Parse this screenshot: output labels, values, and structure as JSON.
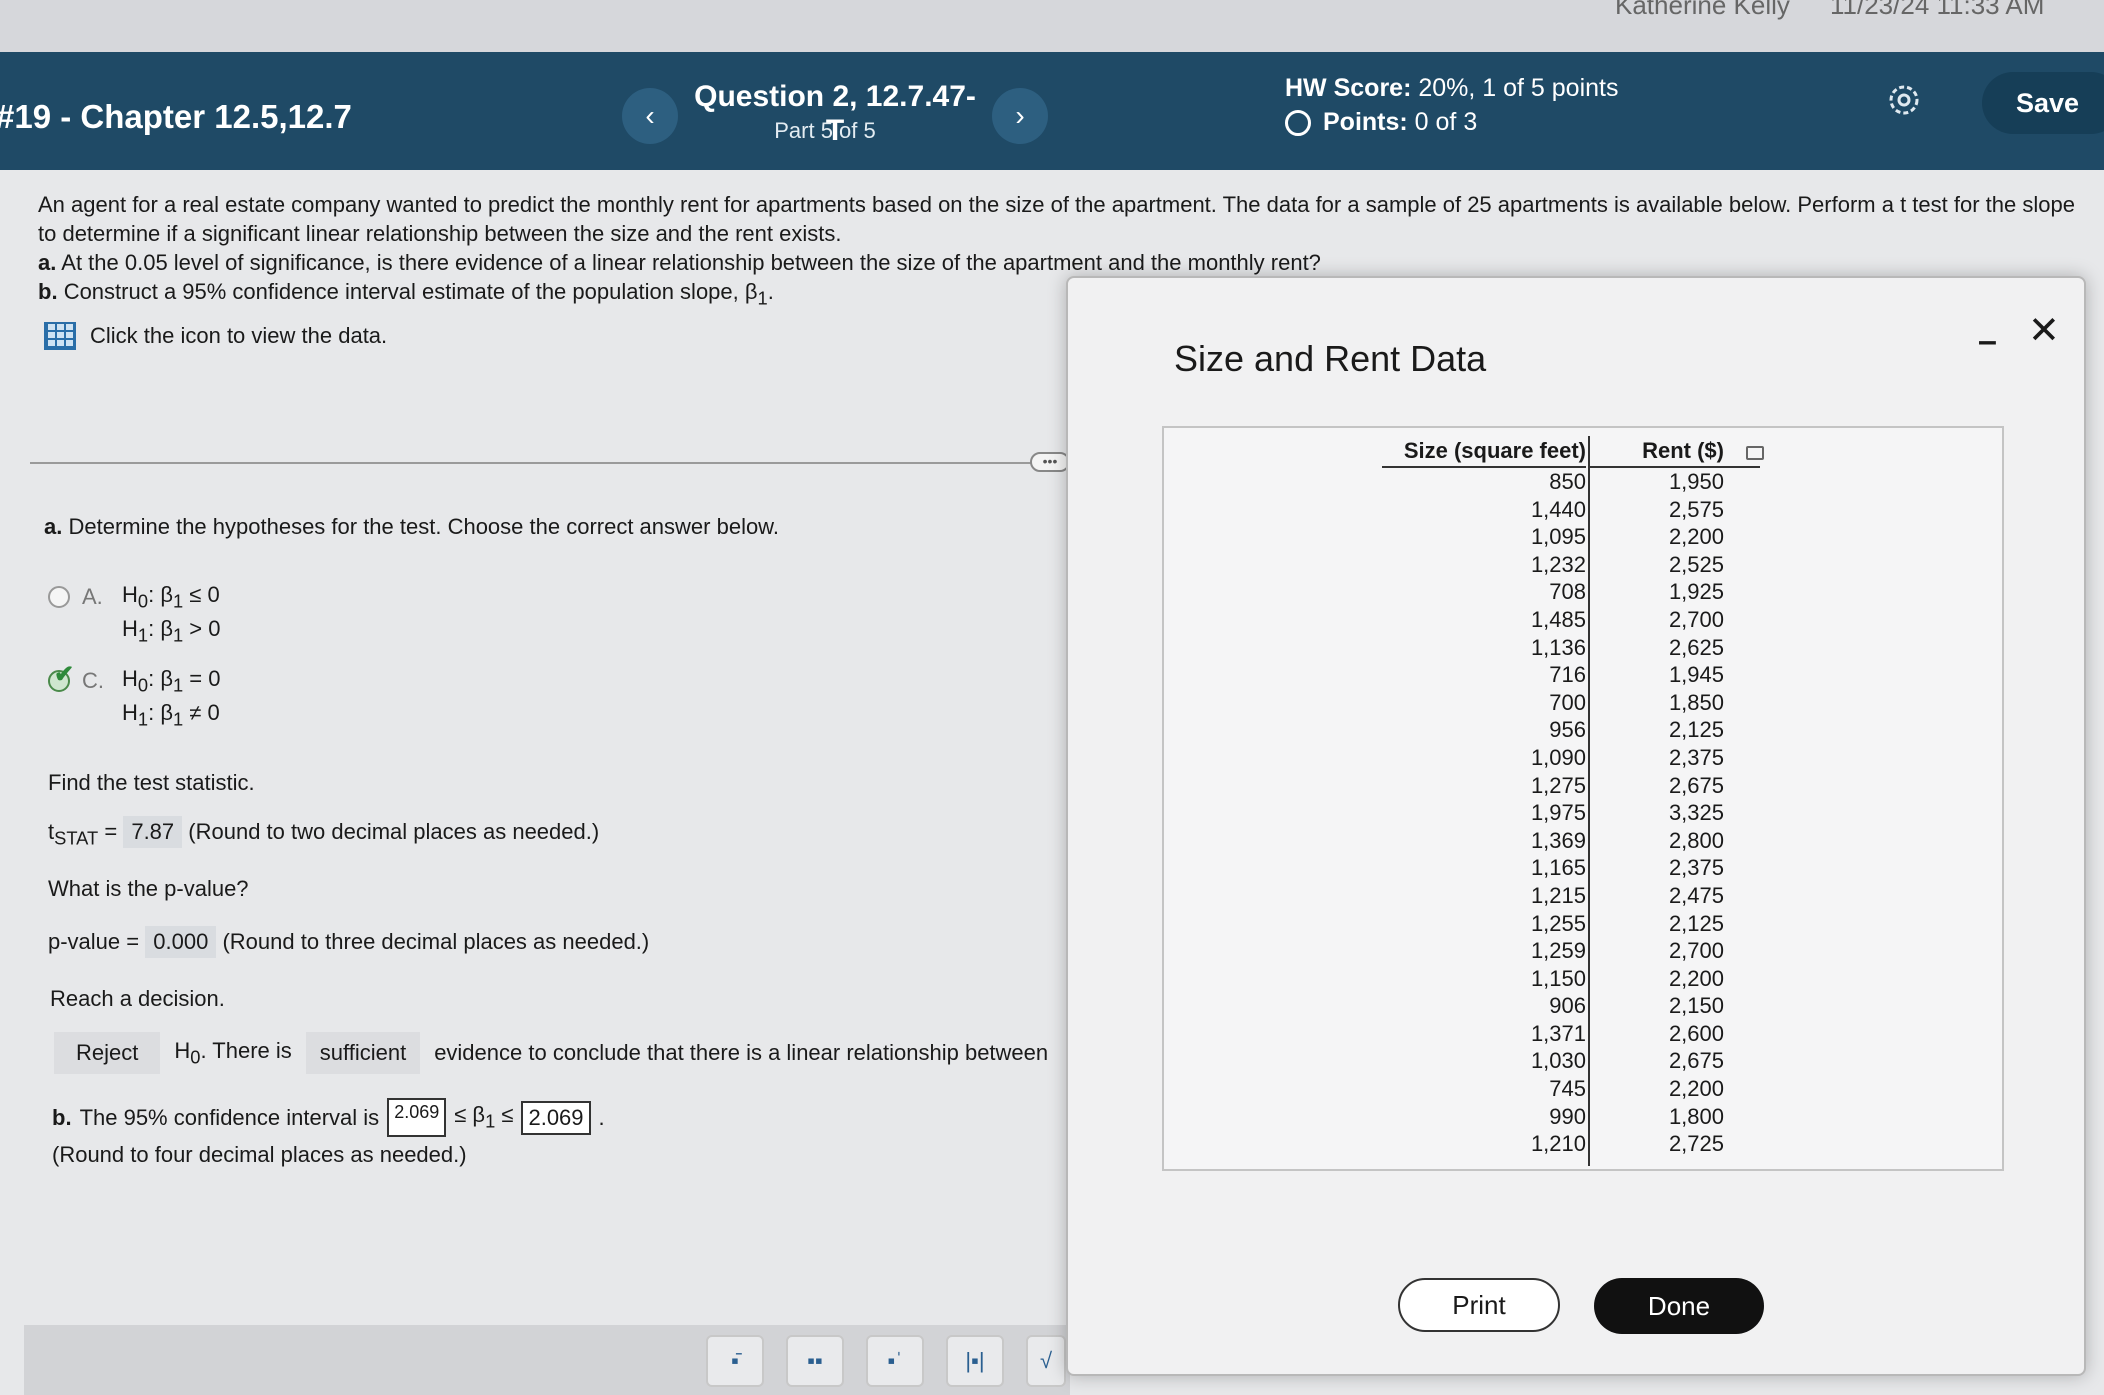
{
  "top_strip": {
    "user": "Katherine Kelly",
    "time": "11/23/24 11:33 AM"
  },
  "header": {
    "hw_title": "#19 - Chapter 12.5,12.7",
    "question_title": "Question 2, 12.7.47-T",
    "question_part": "Part 5 of 5",
    "score_label": "HW Score:",
    "score_value": "20%, 1 of 5 points",
    "points_label": "Points:",
    "points_value": "0 of 3",
    "save_label": "Save",
    "prev_icon": "chevron-left-icon",
    "next_icon": "chevron-right-icon",
    "settings_icon": "gear-icon"
  },
  "problem": {
    "line1": "An agent for a real estate company wanted to predict the monthly rent for apartments based on the size of the apartment. The data for a sample of 25 apartments is available below. Perform a t test for the slope",
    "line2": "to determine if a significant linear relationship between the size and the rent exists.",
    "a_label": "a.",
    "a_text": "At the 0.05 level of significance, is there evidence of a linear relationship between the size of the apartment and the monthly rent?",
    "b_label": "b.",
    "b_text": "Construct a 95% confidence interval estimate of the population slope, β",
    "data_link": "Click the icon to view the data."
  },
  "part_a": {
    "prompt_label": "a.",
    "prompt": "Determine the hypotheses for the test. Choose the correct answer below.",
    "option_a_letter": "A.",
    "option_a_h0": "H",
    "option_a_h0_rest": ": β",
    "option_a_h0_rel": " ≤ 0",
    "option_a_h1_rel": " > 0",
    "option_c_letter": "C.",
    "option_c_h0_rel": " = 0",
    "option_c_h1_rel": " ≠ 0",
    "test_stat_prompt": "Find the test statistic.",
    "t_label": "t",
    "t_sub": "STAT",
    "t_value": "7.87",
    "t_note": "(Round to two decimal places as needed.)",
    "p_prompt": "What is the p-value?",
    "p_label": "p-value =",
    "p_value": "0.000",
    "p_note": "(Round to three decimal places as needed.)",
    "decision_prompt": "Reach a decision.",
    "decision_choice": "Reject",
    "decision_mid": ". There is",
    "evidence_choice": "sufficient",
    "decision_tail": "evidence to conclude that there is a linear relationship between"
  },
  "part_b": {
    "label": "b.",
    "text": "The 95% confidence interval is",
    "lower": "2.069",
    "middle": "≤ β",
    "middle_end": " ≤",
    "upper": "2.069",
    "note": "(Round to four decimal places as needed.)"
  },
  "popup": {
    "title": "Size and Rent Data",
    "minimize_icon": "minimize-icon",
    "close_icon": "close-icon",
    "col_size": "Size (square feet)",
    "col_rent": "Rent ($)",
    "rows": [
      [
        "850",
        "1,950"
      ],
      [
        "1,440",
        "2,575"
      ],
      [
        "1,095",
        "2,200"
      ],
      [
        "1,232",
        "2,525"
      ],
      [
        "708",
        "1,925"
      ],
      [
        "1,485",
        "2,700"
      ],
      [
        "1,136",
        "2,625"
      ],
      [
        "716",
        "1,945"
      ],
      [
        "700",
        "1,850"
      ],
      [
        "956",
        "2,125"
      ],
      [
        "1,090",
        "2,375"
      ],
      [
        "1,275",
        "2,675"
      ],
      [
        "1,975",
        "3,325"
      ],
      [
        "1,369",
        "2,800"
      ],
      [
        "1,165",
        "2,375"
      ],
      [
        "1,215",
        "2,475"
      ],
      [
        "1,255",
        "2,125"
      ],
      [
        "1,259",
        "2,700"
      ],
      [
        "1,150",
        "2,200"
      ],
      [
        "906",
        "2,150"
      ],
      [
        "1,371",
        "2,600"
      ],
      [
        "1,030",
        "2,675"
      ],
      [
        "745",
        "2,200"
      ],
      [
        "990",
        "1,800"
      ],
      [
        "1,210",
        "2,725"
      ]
    ],
    "print_label": "Print",
    "done_label": "Done"
  },
  "toolbar": {
    "tools": [
      "fraction-icon",
      "mixed-number-icon",
      "exponent-icon",
      "absolute-value-icon",
      "sqrt-icon"
    ]
  }
}
